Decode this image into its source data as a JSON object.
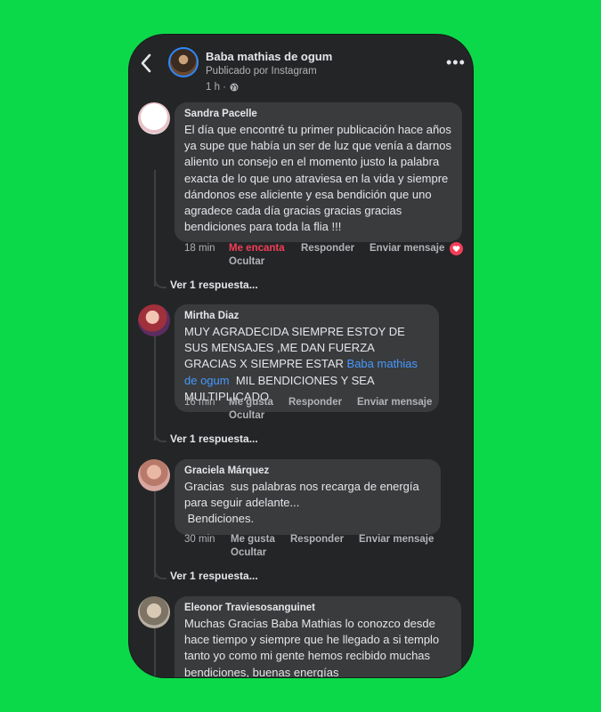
{
  "header": {
    "page_name": "Baba mathias de ogum",
    "posted_via": "Publicado por Instagram",
    "time": "1 h ·"
  },
  "comments": [
    {
      "author": "Sandra Pacelle",
      "text": "El día que encontré tu primer publicación hace años ya supe que había un ser de luz que venía a darnos aliento un consejo en el momento justo la palabra exacta de lo que uno atraviesa en la vida y siempre dándonos ese aliciente y esa bendición que uno agradece cada día gracias gracias gracias bendiciones para toda la flia !!!",
      "time": "18 min",
      "like_label": "Me encanta",
      "reply_label": "Responder",
      "send_label": "Enviar mensaje",
      "hide_label": "Ocultar",
      "replies_label": "Ver 1 respuesta...",
      "reaction": "heart"
    },
    {
      "author": "Mirtha Diaz",
      "text_before": "MUY AGRADECIDA SIEMPRE ESTOY DE SUS MENSAJES ,ME DAN FUERZA   GRACIAS X SIEMPRE ESTAR ",
      "mention": "Baba mathias de ogum",
      "text_after": "  MIL BENDICIONES Y SEA MULTIPLICADO",
      "time": "16 min",
      "like_label": "Me gusta",
      "reply_label": "Responder",
      "send_label": "Enviar mensaje",
      "hide_label": "Ocultar",
      "replies_label": "Ver 1 respuesta..."
    },
    {
      "author": "Graciela Márquez",
      "text": "Gracias  sus palabras nos recarga de energía para seguir adelante...\n Bendiciones.",
      "time": "30 min",
      "like_label": "Me gusta",
      "reply_label": "Responder",
      "send_label": "Enviar mensaje",
      "hide_label": "Ocultar",
      "replies_label": "Ver 1 respuesta..."
    },
    {
      "author": "Eleonor Traviesosanguinet",
      "text": "Muchas Gracias Baba Mathias lo conozco desde hace tiempo y siempre que he llegado a si templo tanto yo como mi gente hemos recibido muchas bendiciones, buenas energías"
    }
  ],
  "colors": {
    "background": "#0bd94a",
    "panel": "#242526",
    "bubble": "#3a3b3c",
    "text": "#e4e6eb",
    "secondary_text": "#b0b3b8",
    "link": "#4599ff",
    "love_red": "#f33e58"
  },
  "icons": [
    "back-chevron-icon",
    "globe-icon",
    "more-options-icon",
    "heart-reaction-icon"
  ]
}
